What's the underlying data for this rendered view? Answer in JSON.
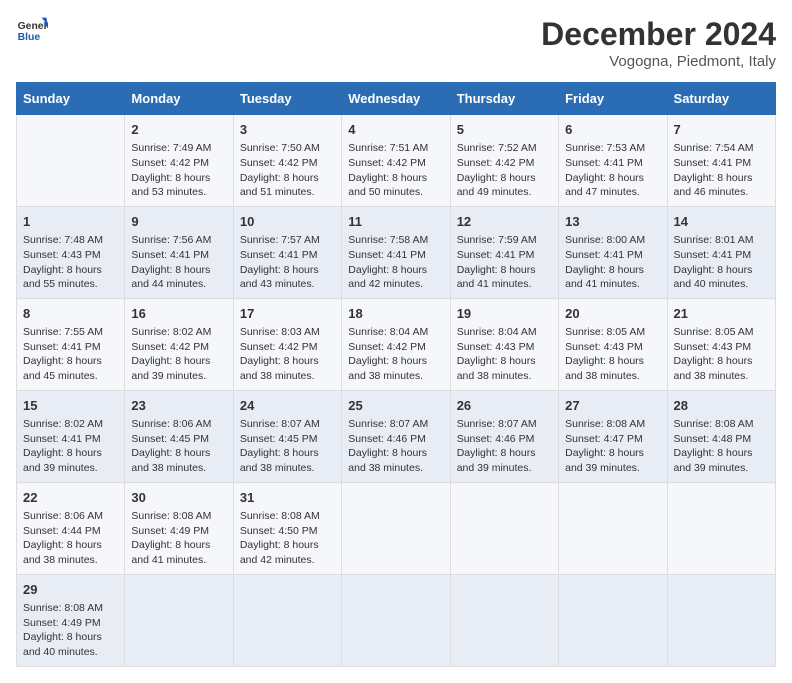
{
  "header": {
    "logo_line1": "General",
    "logo_line2": "Blue",
    "main_title": "December 2024",
    "subtitle": "Vogogna, Piedmont, Italy"
  },
  "calendar": {
    "days_of_week": [
      "Sunday",
      "Monday",
      "Tuesday",
      "Wednesday",
      "Thursday",
      "Friday",
      "Saturday"
    ],
    "weeks": [
      [
        {
          "day": "",
          "info": ""
        },
        {
          "day": "2",
          "info": "Sunrise: 7:49 AM\nSunset: 4:42 PM\nDaylight: 8 hours\nand 53 minutes."
        },
        {
          "day": "3",
          "info": "Sunrise: 7:50 AM\nSunset: 4:42 PM\nDaylight: 8 hours\nand 51 minutes."
        },
        {
          "day": "4",
          "info": "Sunrise: 7:51 AM\nSunset: 4:42 PM\nDaylight: 8 hours\nand 50 minutes."
        },
        {
          "day": "5",
          "info": "Sunrise: 7:52 AM\nSunset: 4:42 PM\nDaylight: 8 hours\nand 49 minutes."
        },
        {
          "day": "6",
          "info": "Sunrise: 7:53 AM\nSunset: 4:41 PM\nDaylight: 8 hours\nand 47 minutes."
        },
        {
          "day": "7",
          "info": "Sunrise: 7:54 AM\nSunset: 4:41 PM\nDaylight: 8 hours\nand 46 minutes."
        }
      ],
      [
        {
          "day": "1",
          "info": "Sunrise: 7:48 AM\nSunset: 4:43 PM\nDaylight: 8 hours\nand 55 minutes."
        },
        {
          "day": "9",
          "info": "Sunrise: 7:56 AM\nSunset: 4:41 PM\nDaylight: 8 hours\nand 44 minutes."
        },
        {
          "day": "10",
          "info": "Sunrise: 7:57 AM\nSunset: 4:41 PM\nDaylight: 8 hours\nand 43 minutes."
        },
        {
          "day": "11",
          "info": "Sunrise: 7:58 AM\nSunset: 4:41 PM\nDaylight: 8 hours\nand 42 minutes."
        },
        {
          "day": "12",
          "info": "Sunrise: 7:59 AM\nSunset: 4:41 PM\nDaylight: 8 hours\nand 41 minutes."
        },
        {
          "day": "13",
          "info": "Sunrise: 8:00 AM\nSunset: 4:41 PM\nDaylight: 8 hours\nand 41 minutes."
        },
        {
          "day": "14",
          "info": "Sunrise: 8:01 AM\nSunset: 4:41 PM\nDaylight: 8 hours\nand 40 minutes."
        }
      ],
      [
        {
          "day": "8",
          "info": "Sunrise: 7:55 AM\nSunset: 4:41 PM\nDaylight: 8 hours\nand 45 minutes."
        },
        {
          "day": "16",
          "info": "Sunrise: 8:02 AM\nSunset: 4:42 PM\nDaylight: 8 hours\nand 39 minutes."
        },
        {
          "day": "17",
          "info": "Sunrise: 8:03 AM\nSunset: 4:42 PM\nDaylight: 8 hours\nand 38 minutes."
        },
        {
          "day": "18",
          "info": "Sunrise: 8:04 AM\nSunset: 4:42 PM\nDaylight: 8 hours\nand 38 minutes."
        },
        {
          "day": "19",
          "info": "Sunrise: 8:04 AM\nSunset: 4:43 PM\nDaylight: 8 hours\nand 38 minutes."
        },
        {
          "day": "20",
          "info": "Sunrise: 8:05 AM\nSunset: 4:43 PM\nDaylight: 8 hours\nand 38 minutes."
        },
        {
          "day": "21",
          "info": "Sunrise: 8:05 AM\nSunset: 4:43 PM\nDaylight: 8 hours\nand 38 minutes."
        }
      ],
      [
        {
          "day": "15",
          "info": "Sunrise: 8:02 AM\nSunset: 4:41 PM\nDaylight: 8 hours\nand 39 minutes."
        },
        {
          "day": "23",
          "info": "Sunrise: 8:06 AM\nSunset: 4:45 PM\nDaylight: 8 hours\nand 38 minutes."
        },
        {
          "day": "24",
          "info": "Sunrise: 8:07 AM\nSunset: 4:45 PM\nDaylight: 8 hours\nand 38 minutes."
        },
        {
          "day": "25",
          "info": "Sunrise: 8:07 AM\nSunset: 4:46 PM\nDaylight: 8 hours\nand 38 minutes."
        },
        {
          "day": "26",
          "info": "Sunrise: 8:07 AM\nSunset: 4:46 PM\nDaylight: 8 hours\nand 39 minutes."
        },
        {
          "day": "27",
          "info": "Sunrise: 8:08 AM\nSunset: 4:47 PM\nDaylight: 8 hours\nand 39 minutes."
        },
        {
          "day": "28",
          "info": "Sunrise: 8:08 AM\nSunset: 4:48 PM\nDaylight: 8 hours\nand 39 minutes."
        }
      ],
      [
        {
          "day": "22",
          "info": "Sunrise: 8:06 AM\nSunset: 4:44 PM\nDaylight: 8 hours\nand 38 minutes."
        },
        {
          "day": "30",
          "info": "Sunrise: 8:08 AM\nSunset: 4:49 PM\nDaylight: 8 hours\nand 41 minutes."
        },
        {
          "day": "31",
          "info": "Sunrise: 8:08 AM\nSunset: 4:50 PM\nDaylight: 8 hours\nand 42 minutes."
        },
        {
          "day": "",
          "info": ""
        },
        {
          "day": "",
          "info": ""
        },
        {
          "day": "",
          "info": ""
        },
        {
          "day": ""
        }
      ],
      [
        {
          "day": "29",
          "info": "Sunrise: 8:08 AM\nSunset: 4:49 PM\nDaylight: 8 hours\nand 40 minutes."
        },
        {
          "day": "",
          "info": ""
        },
        {
          "day": "",
          "info": ""
        },
        {
          "day": "",
          "info": ""
        },
        {
          "day": "",
          "info": ""
        },
        {
          "day": "",
          "info": ""
        },
        {
          "day": "",
          "info": ""
        }
      ]
    ]
  }
}
